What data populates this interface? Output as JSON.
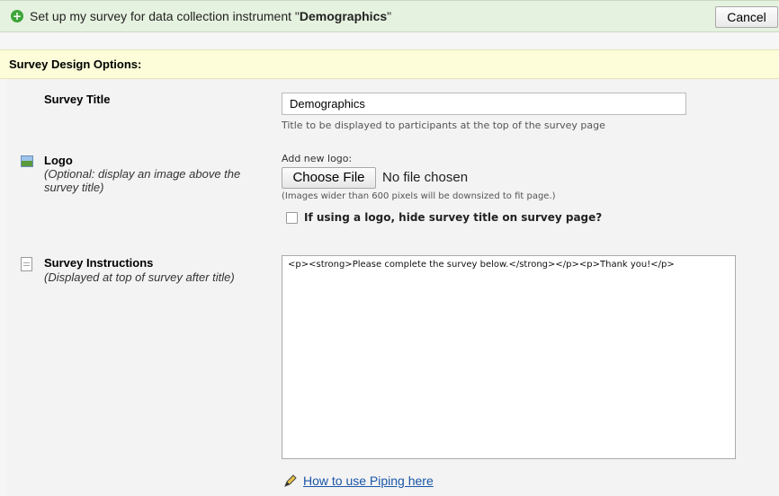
{
  "header": {
    "title_prefix": "Set up my survey for data collection instrument \"",
    "instrument_name": "Demographics",
    "title_suffix": "\"",
    "cancel_label": "Cancel",
    "icon": "plus-circle-icon"
  },
  "section": {
    "title": "Survey Design Options:"
  },
  "survey_title": {
    "label": "Survey Title",
    "value": "Demographics",
    "hint": "Title to be displayed to participants at the top of the survey page"
  },
  "logo": {
    "label": "Logo",
    "description": "(Optional: display an image above the survey title)",
    "add_label": "Add new logo:",
    "choose_file_label": "Choose File",
    "no_file_text": "No file chosen",
    "size_hint": "(Images wider than 600 pixels will be downsized to fit page.)",
    "hide_title_label": "If using a logo, hide survey title on survey page?",
    "hide_title_checked": false,
    "icon": "image-icon"
  },
  "instructions": {
    "label": "Survey Instructions",
    "description": "(Displayed at top of survey after title)",
    "value": "<p><strong>Please complete the survey below.</strong></p><p>Thank you!</p>",
    "icon": "document-icon"
  },
  "piping": {
    "link_label": "How to use Piping here",
    "icon": "pencil-icon"
  },
  "colors": {
    "header_bg": "#e6f2e0",
    "section_bg": "#fdfdd9",
    "link": "#1a56a8",
    "plus_icon": "#3ea53a"
  }
}
